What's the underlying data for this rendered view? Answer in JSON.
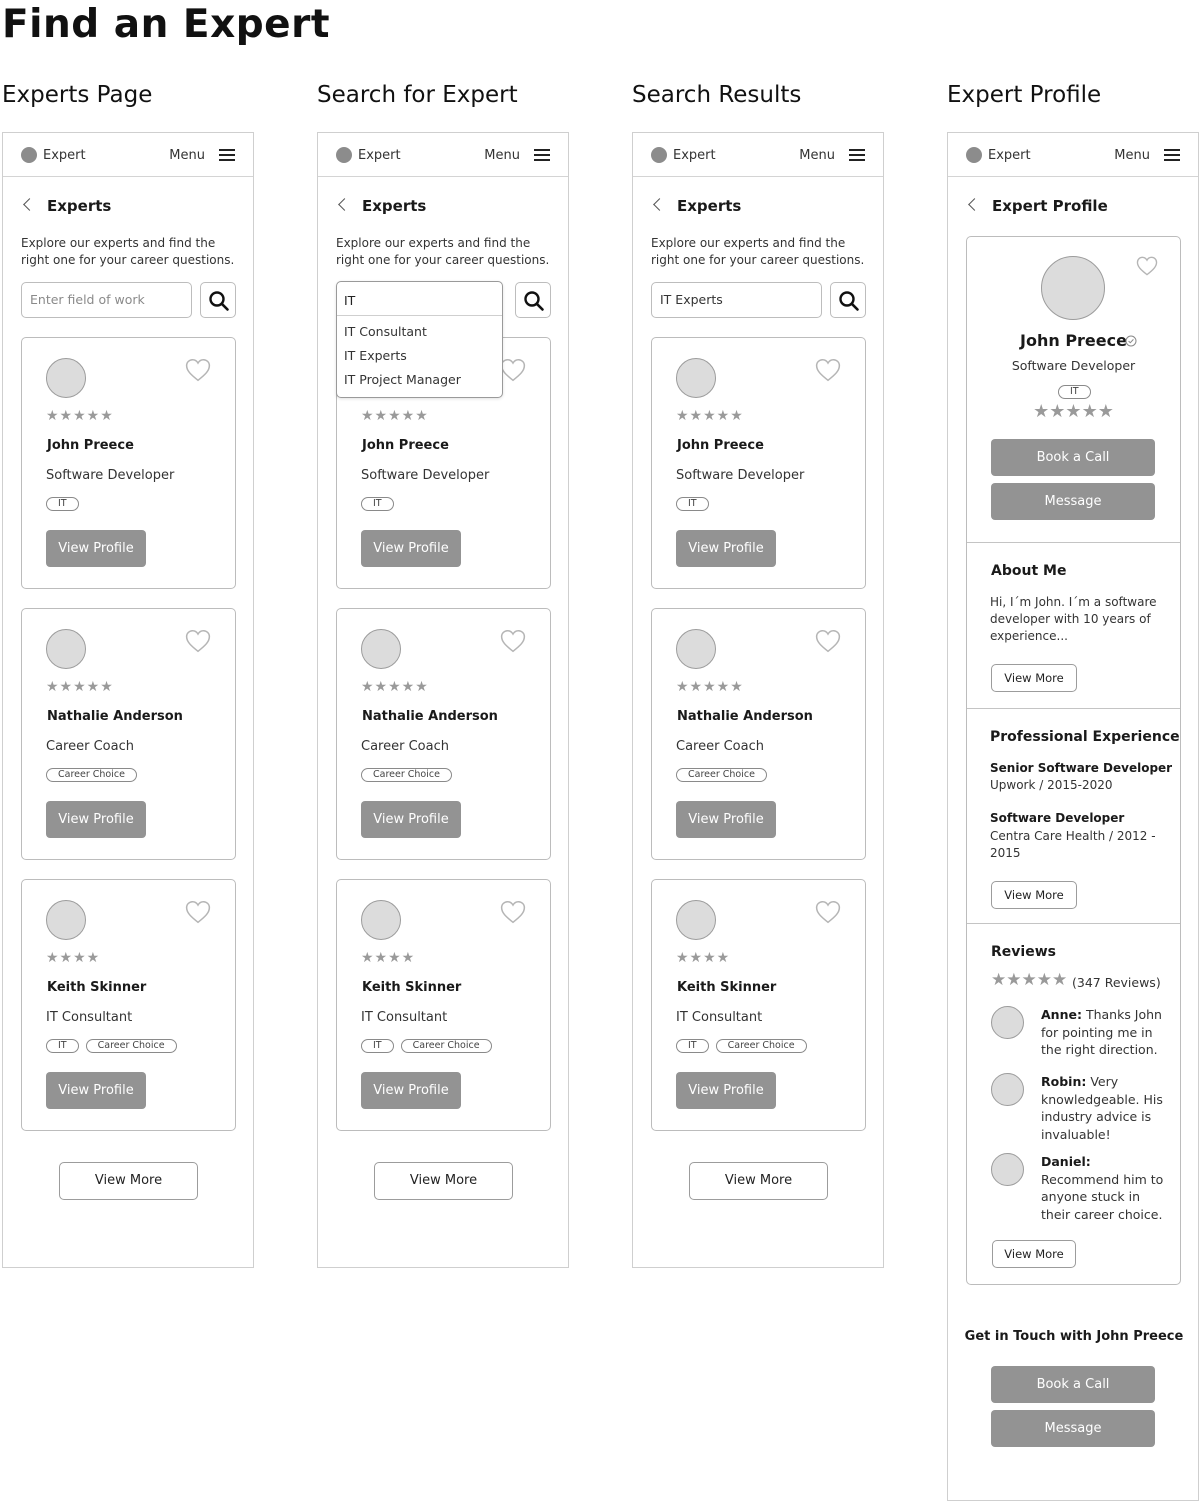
{
  "page_title": "Find an Expert",
  "columns": [
    {
      "title": "Experts Page"
    },
    {
      "title": "Search for Expert"
    },
    {
      "title": "Search Results"
    },
    {
      "title": "Expert Profile"
    }
  ],
  "topbar": {
    "logo": "Expert",
    "menu": "Menu"
  },
  "experts_screen": {
    "heading": "Experts",
    "intro": "Explore our experts and find the right one for your career questions.",
    "search_placeholder": "Enter field of work",
    "dropdown": {
      "value": "IT",
      "options": [
        "IT Consultant",
        "IT Experts",
        "IT Project Manager"
      ]
    },
    "results_query": "IT Experts",
    "cards": [
      {
        "stars": "★★★★★",
        "name": "John Preece",
        "role": "Software Developer",
        "tags": [
          "IT"
        ],
        "button": "View Profile"
      },
      {
        "stars": "★★★★★",
        "name": "Nathalie Anderson",
        "role": "Career Coach",
        "tags": [
          "Career Choice"
        ],
        "button": "View Profile"
      },
      {
        "stars": "★★★★",
        "name": "Keith Skinner",
        "role": "IT Consultant",
        "tags": [
          "IT",
          "Career Choice"
        ],
        "button": "View Profile"
      }
    ],
    "view_more": "View More"
  },
  "profile_screen": {
    "heading": "Expert Profile",
    "name": "John Preece",
    "role": "Software Developer",
    "tag": "IT",
    "stars": "★★★★★",
    "book_call": "Book a Call",
    "message": "Message",
    "about_title": "About Me",
    "about_text": "Hi, I´m John. I´m a software developer with 10 years of experience...",
    "view_more": "View More",
    "experience_title": "Professional Experience",
    "jobs": [
      {
        "title": "Senior Software Developer",
        "detail": "Upwork / 2015-2020"
      },
      {
        "title": "Software Developer",
        "detail": "Centra Care Health / 2012 - 2015"
      }
    ],
    "reviews_title": "Reviews",
    "review_stars": "★★★★★",
    "review_count": "(347 Reviews)",
    "reviews": [
      {
        "author": "Anne:",
        "text": "Thanks John for pointing me in the right direction."
      },
      {
        "author": "Robin:",
        "text": "Very knowledgeable. His industry advice is invaluable!"
      },
      {
        "author": "Daniel:",
        "text": "Recommend him to anyone stuck in their career choice."
      }
    ],
    "get_in_touch": "Get in Touch with John Preece"
  },
  "colors": {
    "button_fill": "#939393",
    "border": "#bcbcbc",
    "avatar": "#dcdcdc",
    "stars": "#9a9a9a"
  },
  "icons": [
    "back-chevron-icon",
    "search-icon",
    "heart-icon",
    "hamburger-menu-icon",
    "verified-check-icon"
  ]
}
